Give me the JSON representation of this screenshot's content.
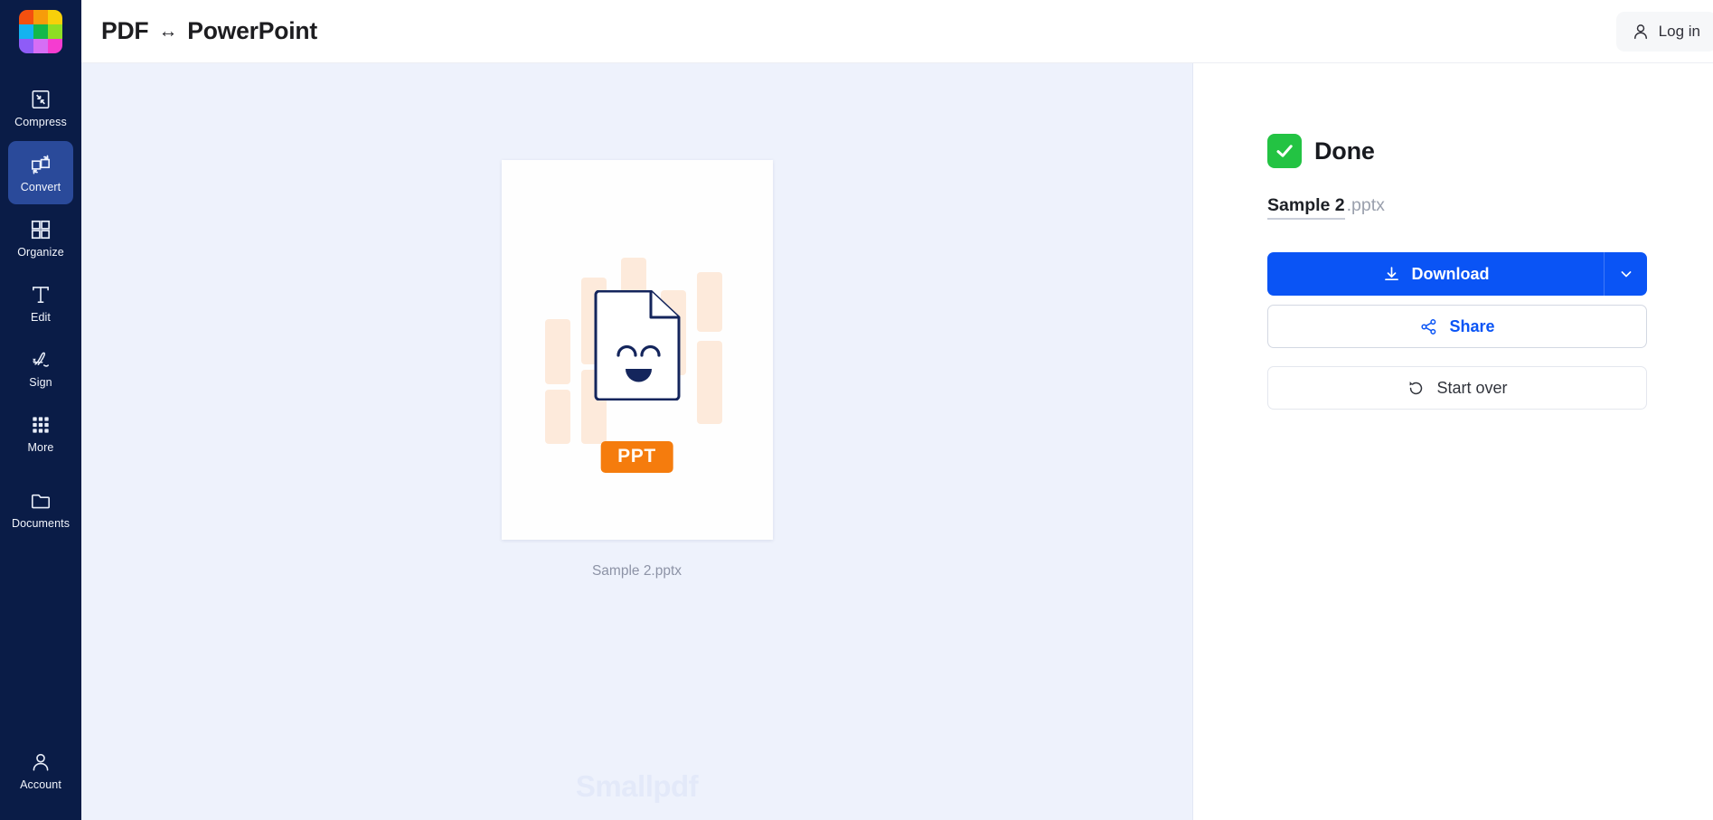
{
  "brand": {
    "logo_name": "smallpdf-logo",
    "logo_colors": [
      "#f4500f",
      "#f79c0a",
      "#f7d00a",
      "#14b3f0",
      "#13b84a",
      "#8ede24",
      "#8e5cf7",
      "#d66ef5",
      "#f53cd0"
    ],
    "watermark": "Smallpdf"
  },
  "header": {
    "title_left": "PDF",
    "title_arrow": "↔",
    "title_right": "PowerPoint",
    "login_label": "Log in",
    "login_icon": "user-icon"
  },
  "sidebar": {
    "items": [
      {
        "id": "compress",
        "label": "Compress",
        "icon": "compress-icon",
        "active": false
      },
      {
        "id": "convert",
        "label": "Convert",
        "icon": "convert-icon",
        "active": true
      },
      {
        "id": "organize",
        "label": "Organize",
        "icon": "organize-icon",
        "active": false
      },
      {
        "id": "edit",
        "label": "Edit",
        "icon": "edit-text-icon",
        "active": false
      },
      {
        "id": "sign",
        "label": "Sign",
        "icon": "signature-icon",
        "active": false
      },
      {
        "id": "more",
        "label": "More",
        "icon": "grid-dots-icon",
        "active": false
      },
      {
        "id": "documents",
        "label": "Documents",
        "icon": "folder-icon",
        "active": false
      }
    ],
    "account": {
      "label": "Account",
      "icon": "account-icon"
    },
    "background": "#0a1c47",
    "active_background": "#2a4a9a"
  },
  "preview": {
    "file_caption": "Sample 2.pptx",
    "badge_label": "PPT",
    "badge_color": "#f57c0d",
    "doc_icon": "smiling-document-icon",
    "bar_color": "#fdeadb"
  },
  "panel": {
    "status_label": "Done",
    "status_icon": "check-icon",
    "status_color": "#23c343",
    "file_basename": "Sample 2",
    "file_extension": ".pptx",
    "download_label": "Download",
    "download_icon": "download-icon",
    "download_caret_icon": "chevron-down-icon",
    "download_color": "#0a54f5",
    "share_label": "Share",
    "share_icon": "share-nodes-icon",
    "startover_label": "Start over",
    "startover_icon": "rotate-left-icon"
  }
}
